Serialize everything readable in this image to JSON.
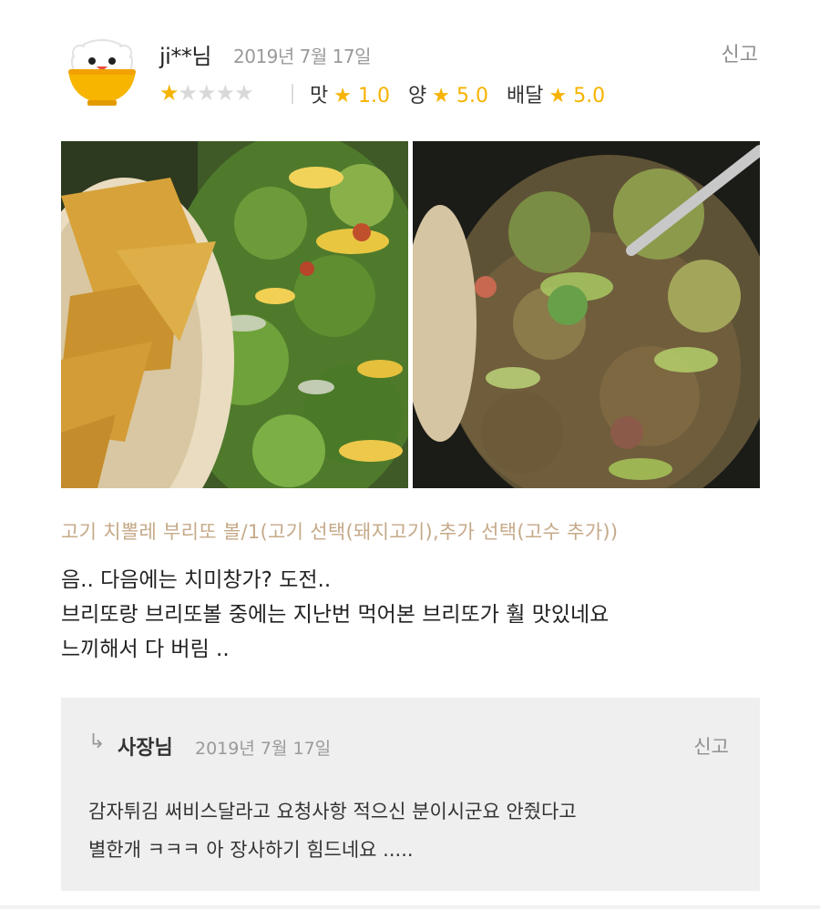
{
  "review": {
    "username": "ji**님",
    "date": "2019년 7월 17일",
    "report_label": "신고",
    "rating": 1,
    "rating_max": 5,
    "sub_ratings": [
      {
        "label": "맛",
        "value": "1.0"
      },
      {
        "label": "양",
        "value": "5.0"
      },
      {
        "label": "배달",
        "value": "5.0"
      }
    ],
    "menu": "고기 치뽈레 부리또 볼/1(고기 선택(돼지고기),추가 선택(고수 추가))",
    "text_lines": [
      "음.. 다음에는 치미창가? 도전..",
      "브리또랑 브리또볼 중에는 지난번 먹어본 브리또가 훨 맛있네요",
      "느끼해서 다 버림 .."
    ]
  },
  "icons": {
    "avatar": "rice-bowl-avatar-icon",
    "star": "star-icon",
    "reply_arrow": "reply-arrow-icon"
  },
  "colors": {
    "star": "#f6b300",
    "menu_text": "#c5a988",
    "reply_bg": "#efefef"
  },
  "reply": {
    "author": "사장님",
    "date": "2019년 7월 17일",
    "report_label": "신고",
    "text_lines": [
      "감자튀김 써비스달라고 요청사항 적으신 분이시군요 안줬다고",
      "별한개 ㅋㅋㅋ 아 장사하기 힘드네요 ....."
    ]
  }
}
